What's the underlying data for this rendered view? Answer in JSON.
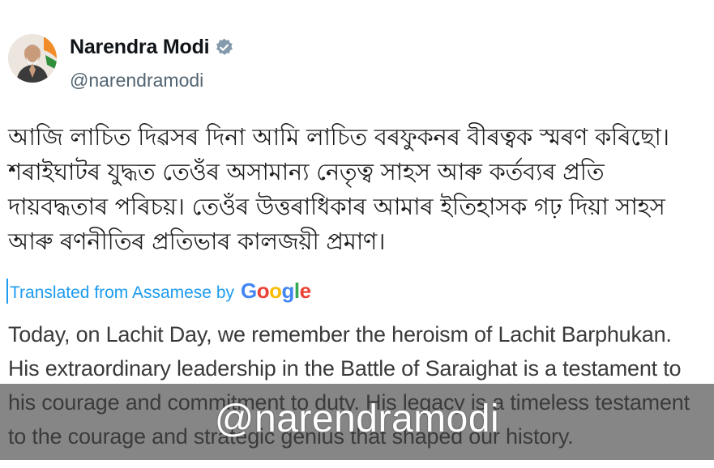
{
  "post": {
    "author": {
      "display_name": "Narendra Modi",
      "handle": "@narendramodi",
      "verified_icon": "verified-badge-icon"
    },
    "original_text": "আজি লাচিত দিৱসৰ দিনা আমি লাচিত বৰফুকনৰ বীৰত্বক স্মৰণ কৰিছো। শৰাইঘাটৰ যুদ্ধত তেওঁৰ অসামান্য নেতৃত্ব সাহস আৰু কৰ্তব্যৰ প্ৰতি দায়বদ্ধতাৰ পৰিচয়। তেওঁৰ উত্তৰাধিকাৰ আমাৰ ইতিহাসক গঢ় দিয়া সাহস আৰু ৰণনীতিৰ প্ৰতিভাৰ কালজয়ী প্ৰমাণ।",
    "translated_label": "Translated from Assamese by",
    "translator_logo": "Google",
    "translation_text": "Today, on Lachit Day, we remember the heroism of Lachit Barphukan. His extraordinary leadership in the Battle of Saraighat is a testament to his courage and commitment to duty. His legacy is a timeless testament to the courage and strategic genius that shaped our history."
  },
  "watermark": {
    "text": "@narendramodi"
  },
  "colors": {
    "link_blue": "#1d9bf0",
    "google_blue": "#4285F4",
    "google_red": "#EA4335",
    "google_yellow": "#FBBC05",
    "google_green": "#34A853",
    "handle_gray": "#536471"
  }
}
